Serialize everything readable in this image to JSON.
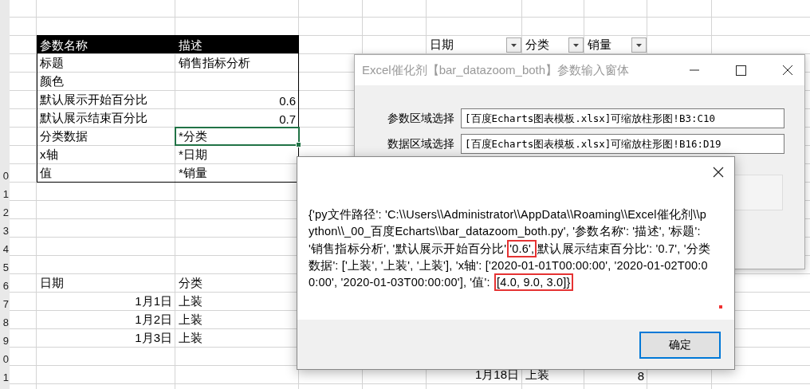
{
  "sheet": {
    "row_numbers": [
      "0",
      "1",
      "2",
      "3",
      "4",
      "5",
      "6",
      "7",
      "8",
      "9",
      "0",
      "1"
    ]
  },
  "param_table": {
    "columns": [
      "参数名称",
      "描述"
    ],
    "rows": [
      {
        "name": "标题",
        "value": "销售指标分析",
        "kind": "text",
        "selected": false
      },
      {
        "name": "颜色",
        "kind": "text",
        "selected": false
      },
      {
        "name": "默认展示开始百分比",
        "value": "0.6",
        "kind": "number",
        "selected": false
      },
      {
        "name": "默认展示结束百分比",
        "value": "0.7",
        "kind": "number",
        "selected": false
      },
      {
        "name": "分类数据",
        "value": "*分类",
        "kind": "text",
        "selected": true
      },
      {
        "name": "x轴",
        "value": "*日期",
        "kind": "text",
        "selected": false
      },
      {
        "name": "值",
        "value": "*销量",
        "kind": "text",
        "selected": false
      }
    ]
  },
  "data_table": {
    "columns": [
      {
        "label": "日期",
        "kind": "date"
      },
      {
        "label": "分类",
        "kind": "text"
      }
    ],
    "rows": [
      {
        "cells": [
          "1月1日",
          "上装"
        ]
      },
      {
        "cells": [
          "1月2日",
          "上装"
        ]
      },
      {
        "cells": [
          "1月3日",
          "上装"
        ]
      }
    ]
  },
  "summary_table": {
    "columns": [
      {
        "label": "日期",
        "kind": "date",
        "filter": true
      },
      {
        "label": "分类",
        "kind": "text",
        "filter": true
      },
      {
        "label": "销量",
        "kind": "number",
        "filter": true
      }
    ],
    "rows": [
      {
        "cells": [
          "1月18日",
          "上装",
          "8"
        ]
      }
    ]
  },
  "param_dialog": {
    "title": "Excel催化剂【bar_datazoom_both】参数输入窗体",
    "fields": [
      {
        "label": "参数区域选择",
        "value": "[百度Echarts图表模板.xlsx]可缩放柱形图!B3:C10"
      },
      {
        "label": "数据区域选择",
        "value": "[百度Echarts图表模板.xlsx]可缩放柱形图!B16:D19"
      }
    ]
  },
  "message_box": {
    "segments": [
      {
        "text": "{'py文件路径': 'C:\\\\Users\\\\Administrator\\\\AppData\\\\Roaming\\\\Excel催化剂\\\\python\\\\_00_百度Echarts\\\\bar_datazoom_both.py', '参数名称': '描述', '标题': '销售指标分析', '默认展示开始百分比'",
        "highlighted": false
      },
      {
        "text": "'0.6',",
        "highlighted": true
      },
      {
        "text": "默认展示结束百分比': '0.7', '分类数据': ['上装', '上装', '上装'], 'x轴': ['2020-01-01T00:00:00', '2020-01-02T00:00:00', '2020-01-03T00:00:00'], '值': ",
        "highlighted": false
      },
      {
        "text": "[4.0, 9.0, 3.0]}",
        "highlighted": true
      }
    ],
    "button": "确定"
  }
}
